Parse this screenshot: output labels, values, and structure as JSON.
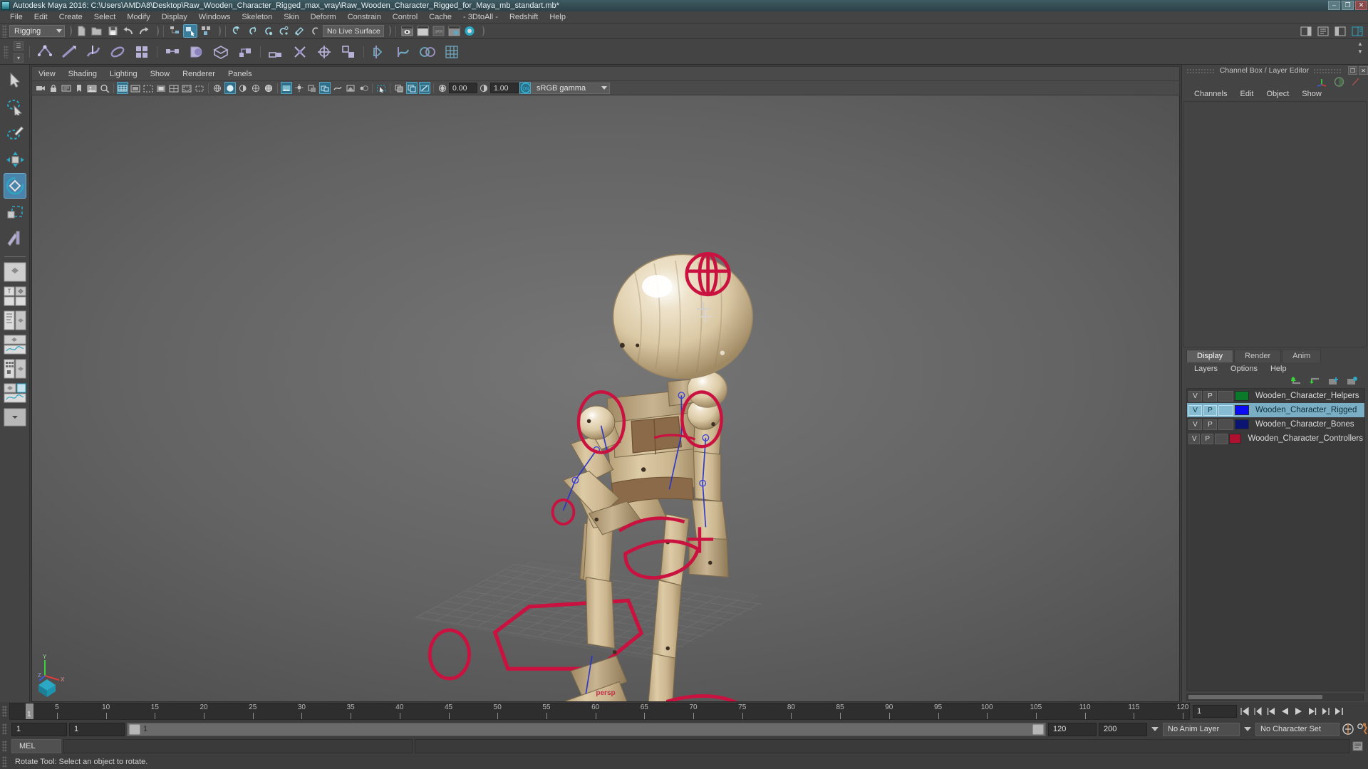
{
  "window": {
    "title": "Autodesk Maya 2016: C:\\Users\\AMDA8\\Desktop\\Raw_Wooden_Character_Rigged_max_vray\\Raw_Wooden_Character_Rigged_for_Maya_mb_standart.mb*",
    "app_icon": "maya-icon",
    "buttons": {
      "minimize": "–",
      "maximize": "❐",
      "close": "✕"
    }
  },
  "menubar": {
    "items": [
      "File",
      "Edit",
      "Create",
      "Select",
      "Modify",
      "Display",
      "Windows",
      "Skeleton",
      "Skin",
      "Deform",
      "Constrain",
      "Control",
      "Cache",
      "- 3DtoAll -",
      "Redshift",
      "Help"
    ]
  },
  "statusline": {
    "menu_set": "Rigging",
    "live_surface": "No Live Surface",
    "icons": [
      "new-scene-icon",
      "open-scene-icon",
      "save-scene-icon",
      "undo-icon",
      "redo-icon",
      "select-by-hierarchy-icon",
      "select-by-object-icon",
      "select-by-component-icon",
      "snap-to-grid-icon",
      "snap-to-curve-icon",
      "snap-to-point-icon",
      "snap-to-projected-center-icon",
      "snap-to-view-plane-icon",
      "make-live-icon",
      "show-render-view-icon",
      "render-current-frame-icon",
      "ipr-render-icon",
      "render-settings-icon",
      "hypershade-icon"
    ],
    "right_icons": [
      "sidebar-toggle-icon",
      "attribute-editor-icon",
      "tool-settings-icon",
      "channel-box-icon"
    ]
  },
  "shelf": {
    "icons": [
      "joint-tool-icon",
      "ik-handle-tool-icon",
      "ik-spline-handle-icon",
      "insert-joint-icon",
      "mirror-joint-icon",
      "bind-skin-icon",
      "smooth-bind-icon",
      "interactive-bind-icon",
      "detach-skin-icon",
      "parent-constraint-icon",
      "point-constraint-icon",
      "orient-constraint-icon",
      "scale-constraint-icon",
      "aim-constraint-icon",
      "pole-vector-icon",
      "create-deformer-icon",
      "edit-deformer-icon",
      "blend-shape-icon",
      "lattice-icon"
    ]
  },
  "toolbox": {
    "tools": [
      {
        "name": "select-tool",
        "selected": false
      },
      {
        "name": "lasso-select-tool",
        "selected": false
      },
      {
        "name": "paint-select-tool",
        "selected": false
      },
      {
        "name": "move-tool",
        "selected": false
      },
      {
        "name": "rotate-tool",
        "selected": true
      },
      {
        "name": "scale-tool",
        "selected": false
      },
      {
        "name": "last-tool-used",
        "selected": false
      }
    ],
    "layout_presets": [
      "single-perspective-layout",
      "four-view-layout",
      "outliner-persp-layout",
      "persp-graph-editor-layout",
      "hypershade-persp-layout",
      "persp-outliner-graph-layout",
      "more-layouts-icon"
    ]
  },
  "viewport": {
    "menus": [
      "View",
      "Shading",
      "Lighting",
      "Show",
      "Renderer",
      "Panels"
    ],
    "toolbar_icons": [
      "select-camera-icon",
      "lock-camera-icon",
      "camera-attributes-icon",
      "bookmark-icon",
      "image-plane-icon",
      "2d-pan-zoom-icon",
      "grid-toggle-icon",
      "film-gate-icon",
      "resolution-gate-icon",
      "gate-mask-icon",
      "field-chart-icon",
      "safe-action-icon",
      "safe-title-icon",
      "wireframe-icon",
      "smooth-shade-all-icon",
      "smooth-shade-selected-icon",
      "flat-shade-icon",
      "shaded-wireframe-icon",
      "texture-toggle-icon",
      "lighting-toggle-icon",
      "shadows-toggle-icon",
      "screen-space-ao-icon",
      "motion-blur-icon",
      "multisample-icon",
      "depth-of-field-icon",
      "isolate-select-icon",
      "xray-toggle-icon",
      "xray-joints-icon",
      "xray-active-components-icon",
      "exposure-icon",
      "gamma-icon",
      "color-management-toggle-icon"
    ],
    "exposure_value": "0.00",
    "gamma_value": "1.00",
    "color_space": "sRGB gamma",
    "color_mgmt_toggle": "ON",
    "camera_label": "persp",
    "axis_labels": {
      "x": "X",
      "y": "Y",
      "z": "Z"
    }
  },
  "right_panel": {
    "title": "Channel Box / Layer Editor",
    "window_buttons": {
      "undock": "❐",
      "close": "✕"
    },
    "header_icons": [
      "show-manipulator-icon",
      "soft-select-icon",
      "symmetry-icon"
    ],
    "channel_menus": [
      "Channels",
      "Edit",
      "Object",
      "Show"
    ],
    "layer_editor": {
      "tabs": [
        {
          "label": "Display",
          "active": true
        },
        {
          "label": "Render",
          "active": false
        },
        {
          "label": "Anim",
          "active": false
        }
      ],
      "menus": [
        "Layers",
        "Options",
        "Help"
      ],
      "tool_icons": [
        "move-layer-up-icon",
        "move-layer-down-icon",
        "new-layer-icon",
        "new-layer-from-selected-icon"
      ],
      "columns": {
        "visibility": "V",
        "playback": "P"
      },
      "layers": [
        {
          "v": "V",
          "p": "P",
          "type": "",
          "color": "#0a7a2a",
          "name": "Wooden_Character_Helpers",
          "selected": false
        },
        {
          "v": "V",
          "p": "P",
          "type": "",
          "color": "#0b0bf5",
          "name": "Wooden_Character_Rigged",
          "selected": true
        },
        {
          "v": "V",
          "p": "P",
          "type": "",
          "color": "#0b1470",
          "name": "Wooden_Character_Bones",
          "selected": false
        },
        {
          "v": "V",
          "p": "P",
          "type": "",
          "color": "#b01030",
          "name": "Wooden_Character_Controllers",
          "selected": false
        }
      ]
    }
  },
  "time_slider": {
    "start": 1,
    "end": 120,
    "current_frame": "1",
    "tick_step": 5,
    "tick_labels": [
      5,
      10,
      15,
      20,
      25,
      30,
      35,
      40,
      45,
      50,
      55,
      60,
      65,
      70,
      75,
      80,
      85,
      90,
      95,
      100,
      105,
      110,
      115,
      120
    ],
    "current_frame_field": "1",
    "playback_buttons": [
      "go-to-start-icon",
      "step-back-frame-icon",
      "step-back-key-icon",
      "play-backwards-icon",
      "play-forwards-icon",
      "step-forward-key-icon",
      "step-forward-frame-icon",
      "go-to-end-icon"
    ]
  },
  "range_slider": {
    "anim_start": "1",
    "playback_start": "1",
    "range_label": "1",
    "playback_end": "120",
    "anim_end": "200",
    "range_bar_value": "120",
    "anim_layer": "No Anim Layer",
    "character_set": "No Character Set",
    "right_icons": [
      "auto-key-icon",
      "animation-preferences-icon"
    ]
  },
  "command_line": {
    "language_tab": "MEL",
    "input_value": "",
    "output_value": ""
  },
  "help_line": {
    "text": "Rotate Tool: Select an object to rotate."
  }
}
